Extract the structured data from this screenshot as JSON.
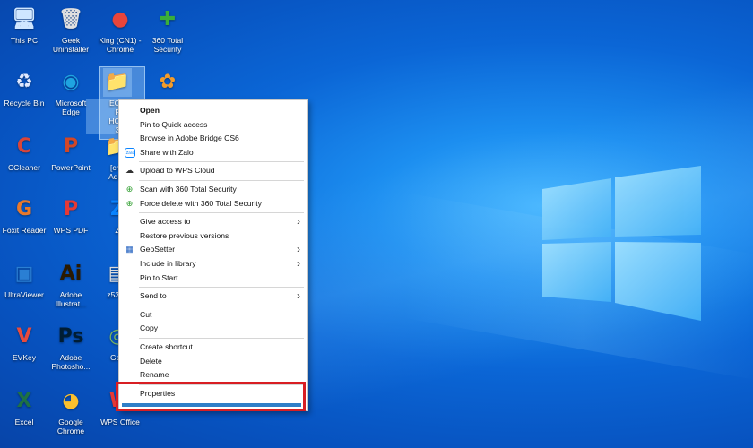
{
  "desktop": {
    "icons": [
      {
        "label": "This PC",
        "glyph": "🖥",
        "color": "#cfe6ff"
      },
      {
        "label": "Geek\nUninstaller",
        "glyph": "🗑",
        "color": "#e0e0e0"
      },
      {
        "label": "King (CN1) -\nChrome",
        "glyph": "●",
        "color": "#e9453a"
      },
      {
        "label": "360 Total\nSecurity",
        "glyph": "✚",
        "color": "#3aaf3a"
      },
      {
        "label": "Recycle Bin",
        "glyph": "♻",
        "color": "#dfe8ff"
      },
      {
        "label": "Microsoft\nEdge",
        "glyph": "◉",
        "color": "#1fa4e0"
      },
      {
        "label": "EOS\nF\nHCM\n3",
        "glyph": "📁",
        "color": "#f5c542"
      },
      {
        "label": "",
        "glyph": "✿",
        "color": "#f29b2a"
      },
      {
        "label": "CCleaner",
        "glyph": "C",
        "color": "#d9453a"
      },
      {
        "label": "PowerPoint",
        "glyph": "P",
        "color": "#d24726"
      },
      {
        "label": "[cntt\nAdob",
        "glyph": "📁",
        "color": "#f5c542"
      },
      {
        "label": "Foxit Reader",
        "glyph": "G",
        "color": "#e9792c"
      },
      {
        "label": "WPS PDF",
        "glyph": "P",
        "color": "#e53935"
      },
      {
        "label": "Z",
        "glyph": "Z",
        "color": "#0a84ff"
      },
      {
        "label": "UltraViewer",
        "glyph": "▣",
        "color": "#2a7fd4"
      },
      {
        "label": "Adobe\nIllustrat...",
        "glyph": "Ai",
        "color": "#2b1a00"
      },
      {
        "label": "z5380",
        "glyph": "▤",
        "color": "#dddddd"
      },
      {
        "label": "EVKey",
        "glyph": "V",
        "color": "#e94b3c"
      },
      {
        "label": "Adobe\nPhotosho...",
        "glyph": "Ps",
        "color": "#001d34"
      },
      {
        "label": "Geo",
        "glyph": "◎",
        "color": "#7bb661"
      },
      {
        "label": "Excel",
        "glyph": "X",
        "color": "#1e7145"
      },
      {
        "label": "Google\nChrome",
        "glyph": "◕",
        "color": "#fbc02d"
      },
      {
        "label": "WPS Office",
        "glyph": "W",
        "color": "#e53935"
      }
    ]
  },
  "context_menu": {
    "items": [
      {
        "label": "Open",
        "icon": "",
        "bold": true,
        "submenu": false
      },
      {
        "label": "Pin to Quick access",
        "icon": "",
        "bold": false,
        "submenu": false
      },
      {
        "label": "Browse in Adobe Bridge CS6",
        "icon": "",
        "bold": false,
        "submenu": false
      },
      {
        "label": "Share with Zalo",
        "icon": "Zalo",
        "bold": false,
        "submenu": false
      },
      {
        "sep": true
      },
      {
        "label": "Upload to WPS Cloud",
        "icon": "☁",
        "bold": false,
        "submenu": false
      },
      {
        "sep": true
      },
      {
        "label": "Scan with 360 Total Security",
        "icon": "⊕",
        "bold": false,
        "submenu": false
      },
      {
        "label": "Force delete with 360 Total Security",
        "icon": "⊕",
        "bold": false,
        "submenu": false
      },
      {
        "sep": true
      },
      {
        "label": "Give access to",
        "icon": "",
        "bold": false,
        "submenu": true
      },
      {
        "label": "Restore previous versions",
        "icon": "",
        "bold": false,
        "submenu": false
      },
      {
        "label": "GeoSetter",
        "icon": "▦",
        "bold": false,
        "submenu": true
      },
      {
        "label": "Include in library",
        "icon": "",
        "bold": false,
        "submenu": true
      },
      {
        "label": "Pin to Start",
        "icon": "",
        "bold": false,
        "submenu": false
      },
      {
        "sep": true
      },
      {
        "label": "Send to",
        "icon": "",
        "bold": false,
        "submenu": true
      },
      {
        "sep": true
      },
      {
        "label": "Cut",
        "icon": "",
        "bold": false,
        "submenu": false
      },
      {
        "label": "Copy",
        "icon": "",
        "bold": false,
        "submenu": false
      },
      {
        "sep": true
      },
      {
        "label": "Create shortcut",
        "icon": "",
        "bold": false,
        "submenu": false
      },
      {
        "label": "Delete",
        "icon": "",
        "bold": false,
        "submenu": false
      },
      {
        "label": "Rename",
        "icon": "",
        "bold": false,
        "submenu": false
      },
      {
        "sep": true
      },
      {
        "label": "Properties",
        "icon": "",
        "bold": false,
        "submenu": false,
        "highlighted": true
      }
    ]
  },
  "colors": {
    "highlight_border": "#d81e23",
    "menu_bg": "#ffffff",
    "desktop_blue": "#0b66d6"
  }
}
